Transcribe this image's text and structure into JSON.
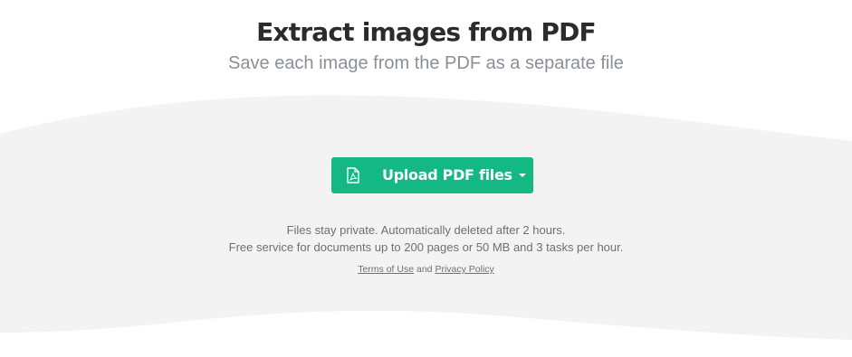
{
  "header": {
    "title": "Extract images from PDF",
    "subtitle": "Save each image from the PDF as a separate file"
  },
  "upload": {
    "label": "Upload PDF files",
    "icon": "pdf-file-icon",
    "dropdown_icon": "caret-down-icon",
    "color": "#13b883"
  },
  "info": {
    "line1": "Files stay private. Automatically deleted after 2 hours.",
    "line2": "Free service for documents up to 200 pages or 50 MB and 3 tasks per hour."
  },
  "legal": {
    "terms_label": "Terms of Use",
    "connector": "and",
    "privacy_label": "Privacy Policy"
  },
  "colors": {
    "background": "#ffffff",
    "wave": "#f3f3f3",
    "title": "#2b2b2b",
    "subtitle": "#8a9097"
  }
}
